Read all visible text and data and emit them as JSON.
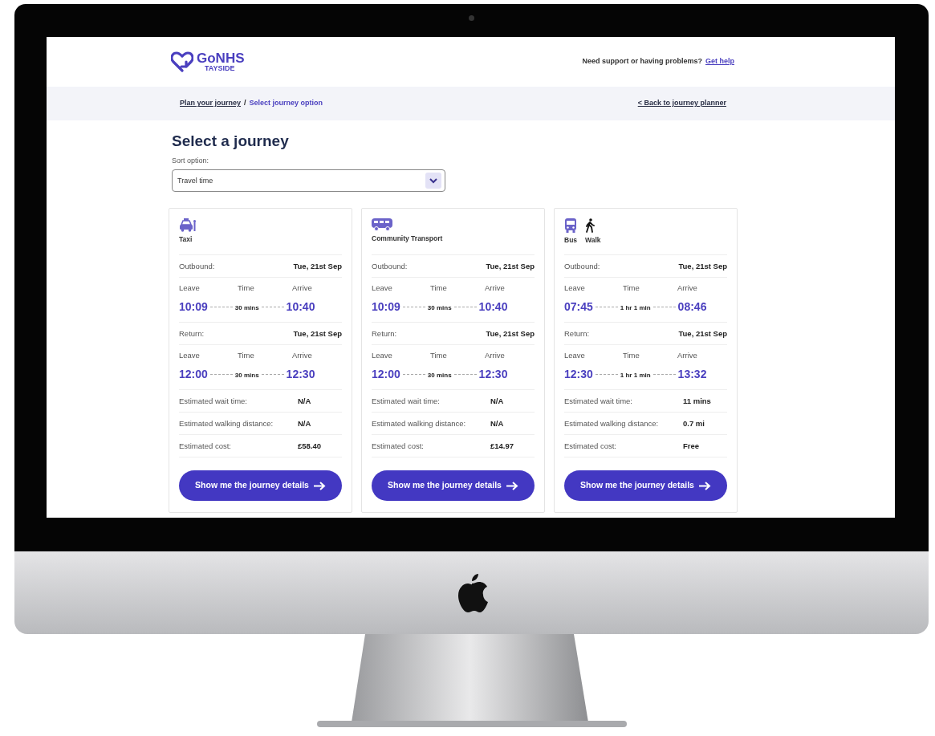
{
  "header": {
    "logo_name": "GoNHS",
    "logo_region": "TAYSIDE",
    "support_text": "Need support or having problems?",
    "help_link": "Get help"
  },
  "breadcrumb": {
    "items": [
      {
        "label": "Plan your journey",
        "current": false
      },
      {
        "label": "Select journey option",
        "current": true
      }
    ],
    "separator": "/",
    "back_link": "< Back to journey planner"
  },
  "title": "Select a journey",
  "sort": {
    "label": "Sort option:",
    "value": "Travel time"
  },
  "options": [
    {
      "modes": [
        {
          "kind": "taxi",
          "label": "Taxi"
        }
      ],
      "legs": [
        {
          "label": "Outbound:",
          "date": "Tue, 21st Sep",
          "leave_label": "Leave",
          "time_label": "Time",
          "arrive_label": "Arrive",
          "leave": "10:09",
          "duration": "30 mins",
          "arrive": "10:40"
        },
        {
          "label": "Return:",
          "date": "Tue, 21st Sep",
          "leave_label": "Leave",
          "time_label": "Time",
          "arrive_label": "Arrive",
          "leave": "12:00",
          "duration": "30 mins",
          "arrive": "12:30"
        }
      ],
      "details": [
        {
          "label": "Estimated wait time:",
          "value": "N/A"
        },
        {
          "label": "Estimated walking distance:",
          "value": "N/A"
        },
        {
          "label": "Estimated cost:",
          "value": "£58.40"
        }
      ],
      "button": "Show me the journey details"
    },
    {
      "modes": [
        {
          "kind": "minibus",
          "label": "Community Transport"
        }
      ],
      "legs": [
        {
          "label": "Outbound:",
          "date": "Tue, 21st Sep",
          "leave_label": "Leave",
          "time_label": "Time",
          "arrive_label": "Arrive",
          "leave": "10:09",
          "duration": "30 mins",
          "arrive": "10:40"
        },
        {
          "label": "Return:",
          "date": "Tue, 21st Sep",
          "leave_label": "Leave",
          "time_label": "Time",
          "arrive_label": "Arrive",
          "leave": "12:00",
          "duration": "30 mins",
          "arrive": "12:30"
        }
      ],
      "details": [
        {
          "label": "Estimated wait time:",
          "value": "N/A"
        },
        {
          "label": "Estimated walking distance:",
          "value": "N/A"
        },
        {
          "label": "Estimated cost:",
          "value": "£14.97"
        }
      ],
      "button": "Show me the journey details"
    },
    {
      "modes": [
        {
          "kind": "bus",
          "label": "Bus"
        },
        {
          "kind": "walk",
          "label": "Walk"
        }
      ],
      "legs": [
        {
          "label": "Outbound:",
          "date": "Tue, 21st Sep",
          "leave_label": "Leave",
          "time_label": "Time",
          "arrive_label": "Arrive",
          "leave": "07:45",
          "duration": "1 hr 1 min",
          "arrive": "08:46"
        },
        {
          "label": "Return:",
          "date": "Tue, 21st Sep",
          "leave_label": "Leave",
          "time_label": "Time",
          "arrive_label": "Arrive",
          "leave": "12:30",
          "duration": "1 hr 1 min",
          "arrive": "13:32"
        }
      ],
      "details": [
        {
          "label": "Estimated wait time:",
          "value": "11 mins"
        },
        {
          "label": "Estimated walking distance:",
          "value": "0.7 mi"
        },
        {
          "label": "Estimated cost:",
          "value": "Free"
        }
      ],
      "button": "Show me the journey details"
    }
  ]
}
